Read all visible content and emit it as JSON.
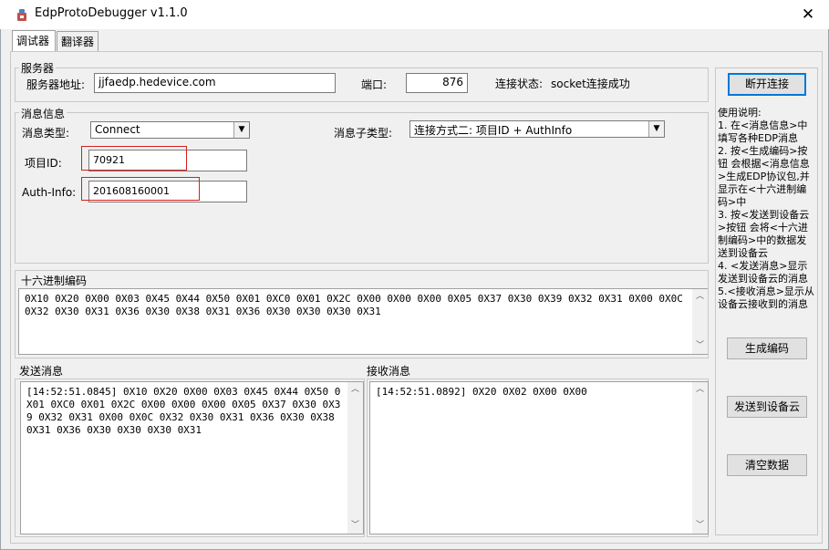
{
  "window": {
    "title": "EdpProtoDebugger v1.1.0",
    "close_glyph": "✕"
  },
  "tabs": [
    {
      "label": "调试器",
      "active": true
    },
    {
      "label": "翻译器",
      "active": false
    }
  ],
  "server": {
    "legend": "服务器",
    "address_label": "服务器地址:",
    "address_value": "jjfaedp.hedevice.com",
    "port_label": "端口:",
    "port_value": "876",
    "status_label": "连接状态:",
    "status_value": "socket连接成功"
  },
  "message": {
    "legend": "消息信息",
    "type_label": "消息类型:",
    "type_value": "Connect",
    "subtype_label": "消息子类型:",
    "subtype_value": "连接方式二: 项目ID + AuthInfo",
    "project_id_label": "项目ID:",
    "project_id_value": "70921",
    "auth_label": "Auth-Info:",
    "auth_value": "201608160001"
  },
  "hex": {
    "legend": "十六进制编码",
    "content": "0X10 0X20 0X00 0X03 0X45 0X44 0X50 0X01 0XC0 0X01 0X2C 0X00 0X00 0X00 0X05 0X37 0X30 0X39 0X32 0X31 0X00 0X0C 0X32 0X30 0X31 0X36 0X30 0X38 0X31 0X36 0X30 0X30 0X30 0X31"
  },
  "send": {
    "label": "发送消息",
    "content": "[14:52:51.0845] 0X10 0X20 0X00 0X03 0X45 0X44 0X50 0X01 0XC0 0X01 0X2C 0X00 0X00 0X00 0X05 0X37 0X30 0X39 0X32 0X31 0X00 0X0C 0X32 0X30 0X31 0X36 0X30 0X38 0X31 0X36 0X30 0X30 0X30 0X31"
  },
  "receive": {
    "label": "接收消息",
    "content": "[14:52:51.0892] 0X20 0X02 0X00 0X00"
  },
  "side": {
    "disconnect_button": "断开连接",
    "help_title": "使用说明:",
    "help_1": "1. 在<消息信息>中填写各种EDP消息",
    "help_2": "2. 按<生成编码>按钮 会根据<消息信息>生成EDP协议包,并显示在<十六进制编码>中",
    "help_3": "3. 按<发送到设备云>按钮 会将<十六进制编码>中的数据发送到设备云",
    "help_4": "4. <发送消息>显示发送到设备云的消息",
    "help_5": "5.<接收消息>显示从设备云接收到的消息",
    "generate_button": "生成编码",
    "send_button": "发送到设备云",
    "clear_button": "清空数据"
  },
  "colors": {
    "accent": "#0078d7",
    "highlight_box": "#d42020"
  }
}
